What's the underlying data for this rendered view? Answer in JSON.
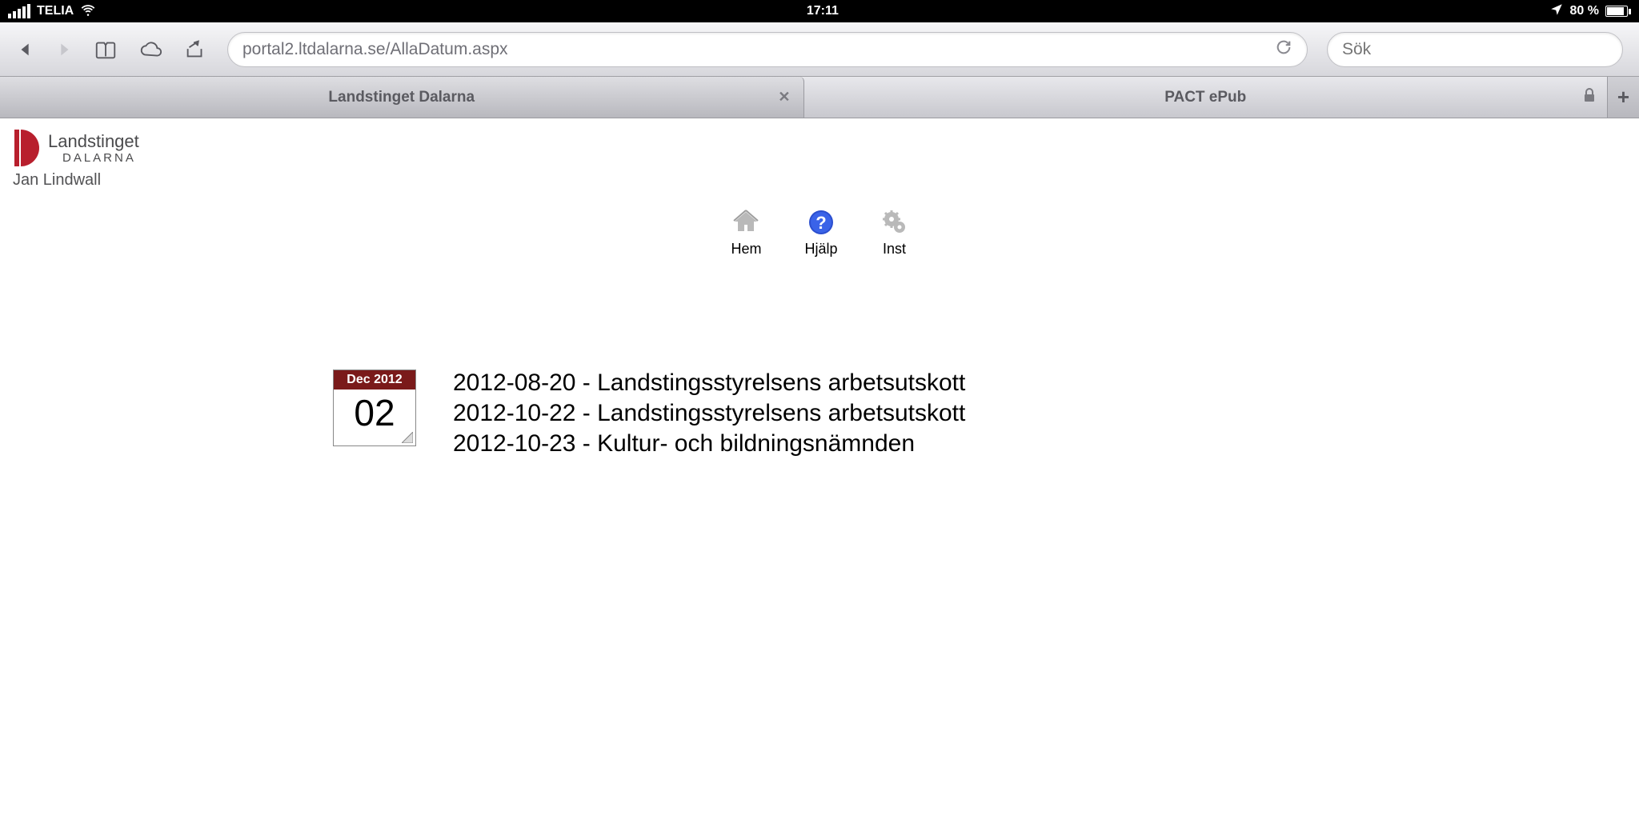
{
  "status": {
    "carrier": "TELIA",
    "time": "17:11",
    "battery_pct": "80 %"
  },
  "browser": {
    "url": "portal2.ltdalarna.se/AllaDatum.aspx",
    "search_placeholder": "Sök"
  },
  "tabs": {
    "active": "Landstinget Dalarna",
    "second": "PACT ePub"
  },
  "logo": {
    "line1": "Landstinget",
    "line2": "DALARNA"
  },
  "user": "Jan Lindwall",
  "nav": {
    "home": "Hem",
    "help": "Hjälp",
    "settings": "Inst"
  },
  "calendar": {
    "month": "Dec 2012",
    "day": "02"
  },
  "events": [
    "2012-08-20 - Landstingsstyrelsens arbetsutskott",
    "2012-10-22 - Landstingsstyrelsens arbetsutskott",
    "2012-10-23 - Kultur- och bildningsnämnden"
  ]
}
